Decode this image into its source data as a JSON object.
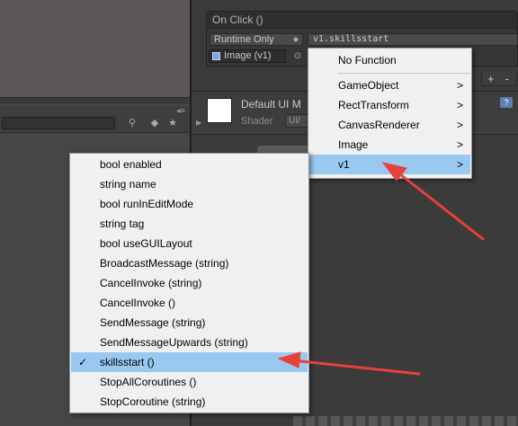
{
  "onclick": {
    "header": "On Click ()",
    "runtime_mode": "Runtime Only",
    "function": "v1.skillsstart",
    "target_object": "Image (v1)"
  },
  "list_buttons": {
    "add": "+",
    "remove": "-"
  },
  "material": {
    "title": "Default UI M",
    "shader_label": "Shader",
    "shader_value": "UI/"
  },
  "menu_components": {
    "items": [
      {
        "label": "No Function",
        "submenu": false,
        "highlighted": false
      },
      {
        "label": "GameObject",
        "submenu": true,
        "highlighted": false
      },
      {
        "label": "RectTransform",
        "submenu": true,
        "highlighted": false
      },
      {
        "label": "CanvasRenderer",
        "submenu": true,
        "highlighted": false
      },
      {
        "label": "Image",
        "submenu": true,
        "highlighted": false
      },
      {
        "label": "v1",
        "submenu": true,
        "highlighted": true
      }
    ],
    "submenu_glyph": ">"
  },
  "menu_methods": {
    "items": [
      {
        "label": "bool enabled",
        "checked": false,
        "highlighted": false
      },
      {
        "label": "string name",
        "checked": false,
        "highlighted": false
      },
      {
        "label": "bool runInEditMode",
        "checked": false,
        "highlighted": false
      },
      {
        "label": "string tag",
        "checked": false,
        "highlighted": false
      },
      {
        "label": "bool useGUILayout",
        "checked": false,
        "highlighted": false
      },
      {
        "label": "BroadcastMessage (string)",
        "checked": false,
        "highlighted": false
      },
      {
        "label": "CancelInvoke (string)",
        "checked": false,
        "highlighted": false
      },
      {
        "label": "CancelInvoke ()",
        "checked": false,
        "highlighted": false
      },
      {
        "label": "SendMessage (string)",
        "checked": false,
        "highlighted": false
      },
      {
        "label": "SendMessageUpwards (string)",
        "checked": false,
        "highlighted": false
      },
      {
        "label": "skillsstart ()",
        "checked": true,
        "highlighted": true
      },
      {
        "label": "StopAllCoroutines ()",
        "checked": false,
        "highlighted": false
      },
      {
        "label": "StopCoroutine (string)",
        "checked": false,
        "highlighted": false
      }
    ],
    "check_glyph": "✓"
  },
  "colors": {
    "menu_bg": "#f0f0f0",
    "menu_highlight": "#99c9f0",
    "annotation_arrow": "#e8403a",
    "editor_dark": "#3b3b3b"
  },
  "icons": {
    "object_picker": "target-icon",
    "help": "help-icon",
    "submenu": "chevron-right-icon",
    "check": "checkmark-icon"
  }
}
